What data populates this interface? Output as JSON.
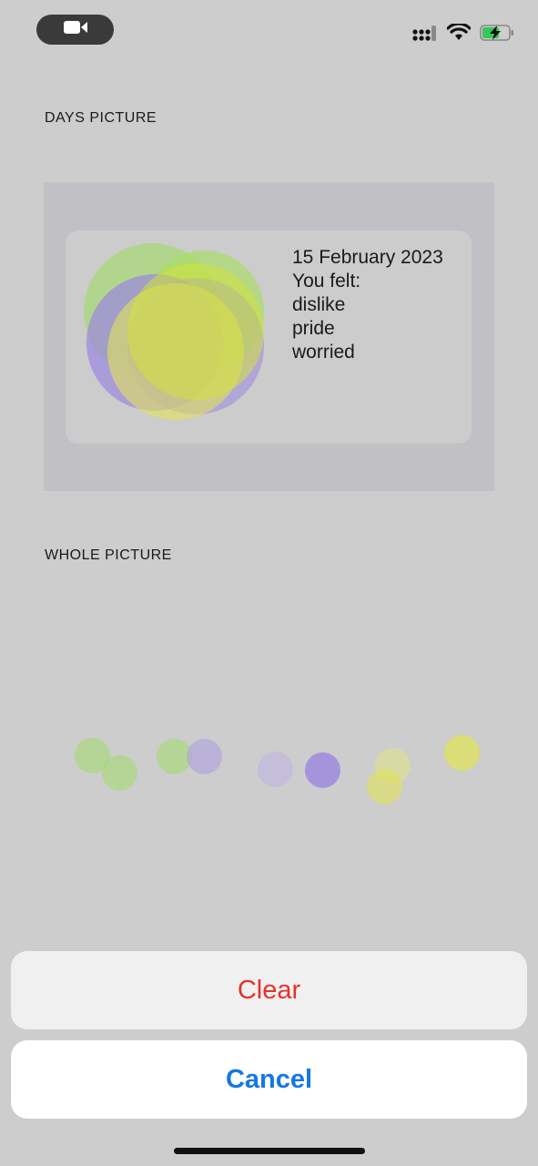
{
  "status_bar": {
    "camera_icon": "video-camera-icon",
    "signal_icon": "cellular-signal-icon",
    "wifi_icon": "wifi-icon",
    "battery_icon": "battery-charging-icon"
  },
  "days_picture": {
    "title": "DAYS PICTURE",
    "date": "15 February 2023",
    "felt_label": "You felt:",
    "emotions": [
      "dislike",
      "pride",
      "worried"
    ]
  },
  "whole_picture": {
    "title": "WHOLE PICTURE"
  },
  "action_sheet": {
    "clear_label": "Clear",
    "cancel_label": "Cancel"
  },
  "colors": {
    "background": "#cdcdcd",
    "clear_text": "#e5322d",
    "cancel_text": "#1677e6",
    "green": "#a8d878",
    "purple": "#9b86e0",
    "yellow": "#dfe25a"
  }
}
